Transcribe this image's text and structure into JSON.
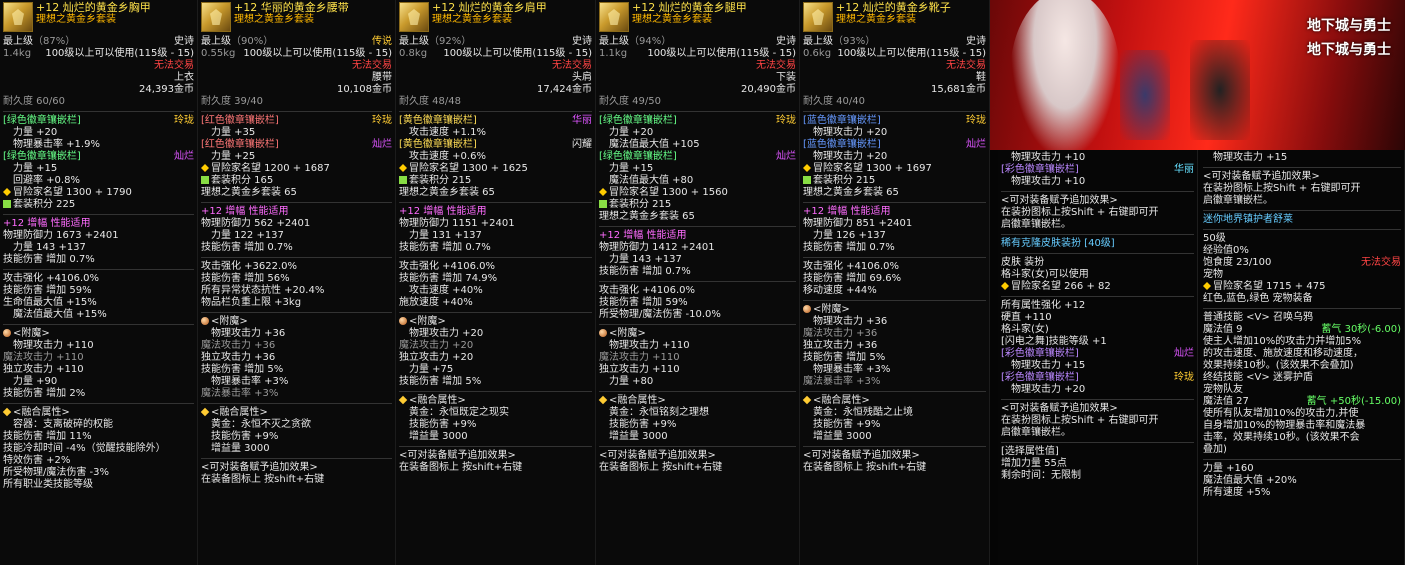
{
  "colors": {
    "epic": "#e8e8e8",
    "legendary": "#ffcc33",
    "untradeable": "#ff4444",
    "amplify": "#ff6cff",
    "set": "#66ff66"
  },
  "items": [
    {
      "id": "chest",
      "icon": "gold-armor-icon",
      "title": "+12 灿烂的黄金乡胸甲",
      "set": "理想之黄金乡套装",
      "grade": "最上级",
      "grade_pct": "（87%）",
      "rarity": "史诗",
      "weight": "1.4kg",
      "level_req": "100级以上可以使用(115级 - 15)",
      "trade": "无法交易",
      "type": "上衣",
      "price": "24,393金币",
      "durability": "耐久度 60/60",
      "lines": [
        "[绿色徽章镶嵌栏]|玲珑",
        "力量 +20",
        "物理暴击率 +1.9%",
        "[绿色徽章镶嵌栏]|灿烂",
        "力量 +15",
        "回避率 +0.8%",
        "冒险家名望 1300 + 1790",
        "套装积分 225",
        "+12 增幅 性能适用",
        "物理防御力 1673 +2401",
        "力量 143 +137",
        "技能伤害 增加 0.7%",
        "攻击强化 +4106.0%",
        "技能伤害 增加 59%",
        "生命值最大值 +15%",
        "魔法值最大值 +15%",
        "<附魔>",
        "物理攻击力 +110",
        "魔法攻击力 +110",
        "独立攻击力 +110",
        "力量 +90",
        "技能伤害 增加 2%",
        "<融合属性>",
        "容器：支离破碎的权能",
        "技能伤害 增加 11%",
        "技能冷却时间 -4%（觉醒技能除外）",
        "特效伤害 +2%",
        "所受物理/魔法伤害 -3%",
        "所有职业类技能等级"
      ]
    },
    {
      "id": "waist",
      "icon": "gold-belt-icon",
      "title": "+12 华丽的黄金乡腰带",
      "set": "理想之黄金乡套装",
      "grade": "最上级",
      "grade_pct": "（90%）",
      "rarity": "传说",
      "weight": "0.55kg",
      "level_req": "100级以上可以使用(115级 - 15)",
      "trade": "无法交易",
      "type": "腰带",
      "price": "10,108金币",
      "durability": "耐久度 39/40",
      "lines": [
        "[红色徽章镶嵌栏]|玲珑",
        "力量 +35",
        "[红色徽章镶嵌栏]|灿烂",
        "力量 +25",
        "冒险家名望 1200 + 1687",
        "套装积分 165",
        "理想之黄金乡套装 65",
        "+12 增幅 性能适用",
        "物理防御力 562 +2401",
        "力量 122 +137",
        "技能伤害 增加 0.7%",
        "攻击强化 +3622.0%",
        "技能伤害 增加 56%",
        "所有异常状态抗性 +20.4%",
        "物品栏负重上限 +3kg",
        "<附魔>",
        "物理攻击力 +36",
        "魔法攻击力 +36",
        "独立攻击力 +36",
        "技能伤害 增加 5%",
        "物理暴击率 +3%",
        "魔法暴击率 +3%",
        "<融合属性>",
        "黄金：永恒不灭之贪欲",
        "技能伤害 +9%",
        "增益量 3000",
        "<可对装备赋予追加效果>",
        "在装备图标上 按shift+右键"
      ]
    },
    {
      "id": "shoulder",
      "icon": "gold-shoulder-icon",
      "title": "+12 灿烂的黄金乡肩甲",
      "set": "理想之黄金乡套装",
      "grade": "最上级",
      "grade_pct": "（92%）",
      "rarity": "史诗",
      "weight": "0.8kg",
      "level_req": "100级以上可以使用(115级 - 15)",
      "trade": "无法交易",
      "type": "头肩",
      "price": "17,424金币",
      "durability": "耐久度 48/48",
      "lines": [
        "[黄色徽章镶嵌栏]|华丽",
        "攻击速度 +1.1%",
        "[黄色徽章镶嵌栏]|闪耀",
        "攻击速度 +0.6%",
        "冒险家名望 1300 + 1625",
        "套装积分 215",
        "理想之黄金乡套装 65",
        "+12 增幅 性能适用",
        "物理防御力 1151 +2401",
        "力量 131 +137",
        "技能伤害 增加 0.7%",
        "攻击强化 +4106.0%",
        "技能伤害 增加 74.9%",
        "攻击速度 +40%",
        "施放速度 +40%",
        "<附魔>",
        "物理攻击力 +20",
        "魔法攻击力 +20",
        "独立攻击力 +20",
        "力量 +75",
        "技能伤害 增加 5%",
        "<融合属性>",
        "黄金：永恒既定之现实",
        "技能伤害 +9%",
        "增益量 3000",
        "<可对装备赋予追加效果>",
        "在装备图标上 按shift+右键"
      ]
    },
    {
      "id": "legs",
      "icon": "gold-pants-icon",
      "title": "+12 灿烂的黄金乡腿甲",
      "set": "理想之黄金乡套装",
      "grade": "最上级",
      "grade_pct": "（94%）",
      "rarity": "史诗",
      "weight": "1.1kg",
      "level_req": "100级以上可以使用(115级 - 15)",
      "trade": "无法交易",
      "type": "下装",
      "price": "20,490金币",
      "durability": "耐久度 49/50",
      "lines": [
        "[绿色徽章镶嵌栏]|玲珑",
        "力量 +20",
        "魔法值最大值 +105",
        "[绿色徽章镶嵌栏]|灿烂",
        "力量 +15",
        "魔法值最大值 +80",
        "冒险家名望 1300 + 1560",
        "套装积分 215",
        "理想之黄金乡套装 65",
        "+12 增幅 性能适用",
        "物理防御力 1412 +2401",
        "力量 143 +137",
        "技能伤害 增加 0.7%",
        "攻击强化 +4106.0%",
        "技能伤害 增加 59%",
        "所受物理/魔法伤害 -10.0%",
        "<附魔>",
        "物理攻击力 +110",
        "魔法攻击力 +110",
        "独立攻击力 +110",
        "力量 +80",
        "<融合属性>",
        "黄金：永恒铭刻之理想",
        "技能伤害 +9%",
        "增益量 3000",
        "<可对装备赋予追加效果>",
        "在装备图标上 按shift+右键"
      ]
    },
    {
      "id": "shoes",
      "icon": "gold-shoes-icon",
      "title": "+12 灿烂的黄金乡靴子",
      "set": "理想之黄金乡套装",
      "grade": "最上级",
      "grade_pct": "（93%）",
      "rarity": "史诗",
      "weight": "0.6kg",
      "level_req": "100级以上可以使用(115级 - 15)",
      "trade": "无法交易",
      "type": "鞋",
      "price": "15,681金币",
      "durability": "耐久度 40/40",
      "lines": [
        "[蓝色徽章镶嵌栏]|玲珑",
        "物理攻击力 +20",
        "[蓝色徽章镶嵌栏]|灿烂",
        "物理攻击力 +20",
        "冒险家名望 1300 + 1697",
        "套装积分 215",
        "理想之黄金乡套装 65",
        "+12 增幅 性能适用",
        "物理防御力 851 +2401",
        "力量 126 +137",
        "技能伤害 增加 0.7%",
        "攻击强化 +4106.0%",
        "技能伤害 增加 69.6%",
        "移动速度 +44%",
        "<附魔>",
        "物理攻击力 +36",
        "魔法攻击力 +36",
        "独立攻击力 +36",
        "技能伤害 增加 5%",
        "物理暴击率 +3%",
        "魔法暴击率 +3%",
        "<融合属性>",
        "黄金：永恒残酷之止境",
        "技能伤害 +9%",
        "增益量 3000",
        "<可对装备赋予追加效果>",
        "在装备图标上 按shift+右键"
      ]
    }
  ],
  "banner": {
    "logo_line1": "地下城与勇士",
    "logo_line2": "地下城与勇士"
  },
  "skin_panel": {
    "lines": [
      "物理攻击力 +10",
      "[彩色徽章镶嵌栏]|华丽",
      "物理攻击力 +10",
      "<可对装备赋予追加效果>",
      "在装扮图标上按Shift + 右键即可开",
      "启徽章镶嵌栏。",
      "稀有克隆皮肤装扮 [40级]",
      "皮肤 装扮",
      "格斗家(女)可以使用",
      "冒险家名望 266 + 82",
      "所有属性强化 +12",
      "硬直 +110",
      "格斗家(女)",
      "[闪电之舞]技能等级 +1",
      "[彩色徽章镶嵌栏]|灿烂",
      "物理攻击力 +15",
      "[彩色徽章镶嵌栏]|玲珑",
      "物理攻击力 +20",
      "<可对装备赋予追加效果>",
      "在装扮图标上按Shift + 右键即可开",
      "启徽章镶嵌栏。",
      "[选择属性值]",
      "增加力量 55点",
      "剩余时间：无限制"
    ]
  },
  "pet_panel": {
    "lines": [
      "物理攻击力 +15",
      "<可对装备赋予追加效果>",
      "在装扮图标上按Shift + 右键即可开",
      "启徽章镶嵌栏。",
      "迷你地界镇护者舒莱",
      "50级",
      "经验值0%",
      "饱食度 23/100|无法交易",
      "宠物",
      "冒险家名望 1715 + 475",
      "红色,蓝色,绿色 宠物装备",
      "普通技能 <V> 召唤乌鸦",
      "魔法值 9|蓄气 30秒(-6.00)",
      "使主人增加10%的攻击力并增加5%",
      "的攻击速度、施放速度和移动速度，",
      "效果持续10秒。(该效果不会叠加)",
      "终结技能 <V> 迷雾护盾",
      "宠物队友",
      "魔法值 27|蓄气 +50秒(-15.00)",
      "使所有队友增加10%的攻击力,并使",
      "自身增加10%的物理暴击率和魔法暴",
      "击率，效果持续10秒。(该效果不会",
      "叠加)",
      "力量 +160",
      "魔法值最大值 +20%",
      "所有速度 +5%"
    ]
  }
}
